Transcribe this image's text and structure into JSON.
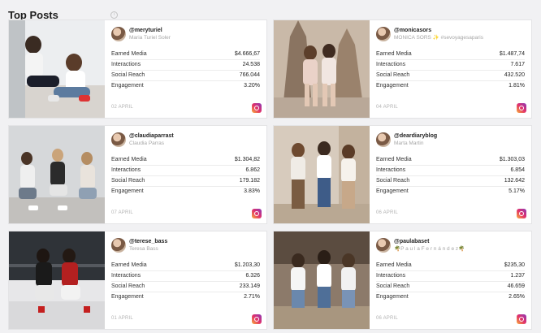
{
  "header": {
    "title": "Top Posts"
  },
  "labels": {
    "earned": "Earned Media",
    "interactions": "Interactions",
    "reach": "Social Reach",
    "engagement": "Engagement"
  },
  "posts": [
    {
      "handle": "@meryturiel",
      "name": "Maria Turiel Soler",
      "earned": "$4.666,67",
      "interactions": "24.538",
      "reach": "766.044",
      "engagement": "3.20%",
      "date": "02 APRIL"
    },
    {
      "handle": "@monicasors",
      "name": "MONICA SORS ✨ #sevoyagesaparis",
      "earned": "$1.487,74",
      "interactions": "7.617",
      "reach": "432.520",
      "engagement": "1.81%",
      "date": "04 APRIL"
    },
    {
      "handle": "@claudiaparrast",
      "name": "Claudia Parras",
      "earned": "$1.304,82",
      "interactions": "6.862",
      "reach": "179.182",
      "engagement": "3.83%",
      "date": "07 APRIL"
    },
    {
      "handle": "@deardiaryblog",
      "name": "Marta Martin",
      "earned": "$1.303,03",
      "interactions": "6.854",
      "reach": "132.642",
      "engagement": "5.17%",
      "date": "06 APRIL"
    },
    {
      "handle": "@terese_bass",
      "name": "Teresa Bass",
      "earned": "$1.203,30",
      "interactions": "6.326",
      "reach": "233.149",
      "engagement": "2.71%",
      "date": "01 APRIL"
    },
    {
      "handle": "@paulabaset",
      "name": "🌴P a u l a F e r n á n d e z🌴",
      "earned": "$235,30",
      "interactions": "1.237",
      "reach": "46.659",
      "engagement": "2.65%",
      "date": "06 APRIL"
    }
  ],
  "icons": {
    "card_corner": "plus-icon",
    "platform": "instagram-icon",
    "header_info": "info-icon"
  },
  "colors": {
    "background": "#f1f1f3",
    "card": "#ffffff",
    "muted_text": "#a6a6a6"
  }
}
